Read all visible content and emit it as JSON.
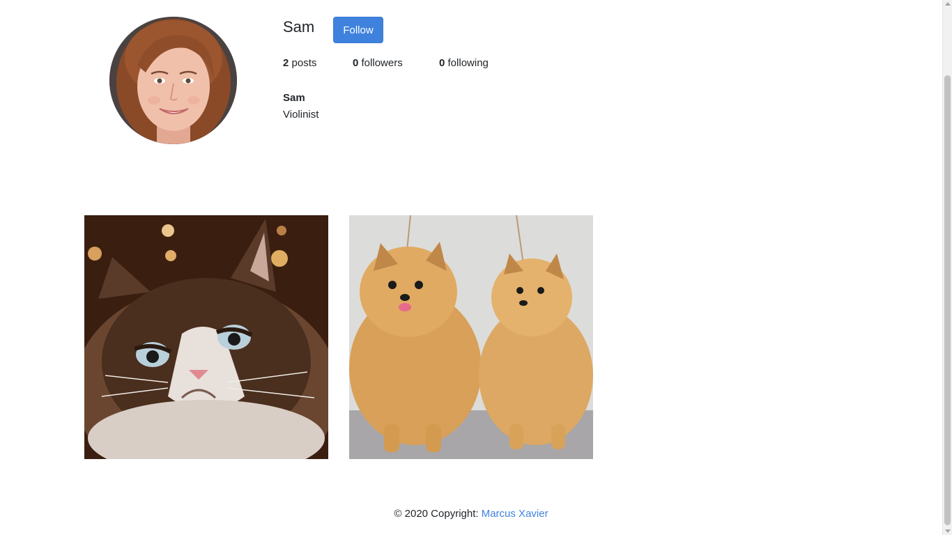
{
  "profile": {
    "username": "Sam",
    "follow_label": "Follow",
    "full_name": "Sam",
    "bio": "Violinist",
    "stats": {
      "posts_count": "2",
      "posts_label": "posts",
      "followers_count": "0",
      "followers_label": "followers",
      "following_count": "0",
      "following_label": "following"
    }
  },
  "posts": [
    {
      "subject": "grumpy-cat"
    },
    {
      "subject": "two-pomeranian-dogs"
    }
  ],
  "footer": {
    "copyright_text": "© 2020 Copyright: ",
    "author_link": "Marcus Xavier"
  },
  "colors": {
    "accent": "#3f82dd",
    "text": "#212529"
  }
}
